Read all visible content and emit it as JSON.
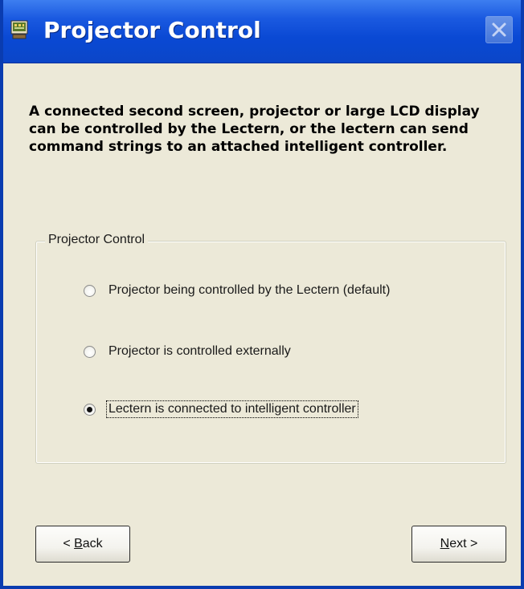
{
  "window": {
    "title": "Projector Control"
  },
  "description": "A connected second screen, projector or large LCD display can be controlled by the Lectern, or the lectern can send command strings to an attached intelligent controller.",
  "group": {
    "label": "Projector Control",
    "options": [
      {
        "label": "Projector being controlled by the Lectern (default)",
        "selected": false
      },
      {
        "label": "Projector is controlled externally",
        "selected": false
      },
      {
        "label": "Lectern is connected to intelligent controller",
        "selected": true
      }
    ]
  },
  "buttons": {
    "back": {
      "prefix": "< ",
      "mnemonic": "B",
      "rest": "ack"
    },
    "next": {
      "prefix": "",
      "mnemonic": "N",
      "rest": "ext >"
    }
  },
  "icons": {
    "app": "projector-app-icon",
    "close": "close-icon"
  },
  "colors": {
    "titlebar": "#0a49d4",
    "window_bg": "#ece9d8",
    "title_text": "#ffffff"
  }
}
